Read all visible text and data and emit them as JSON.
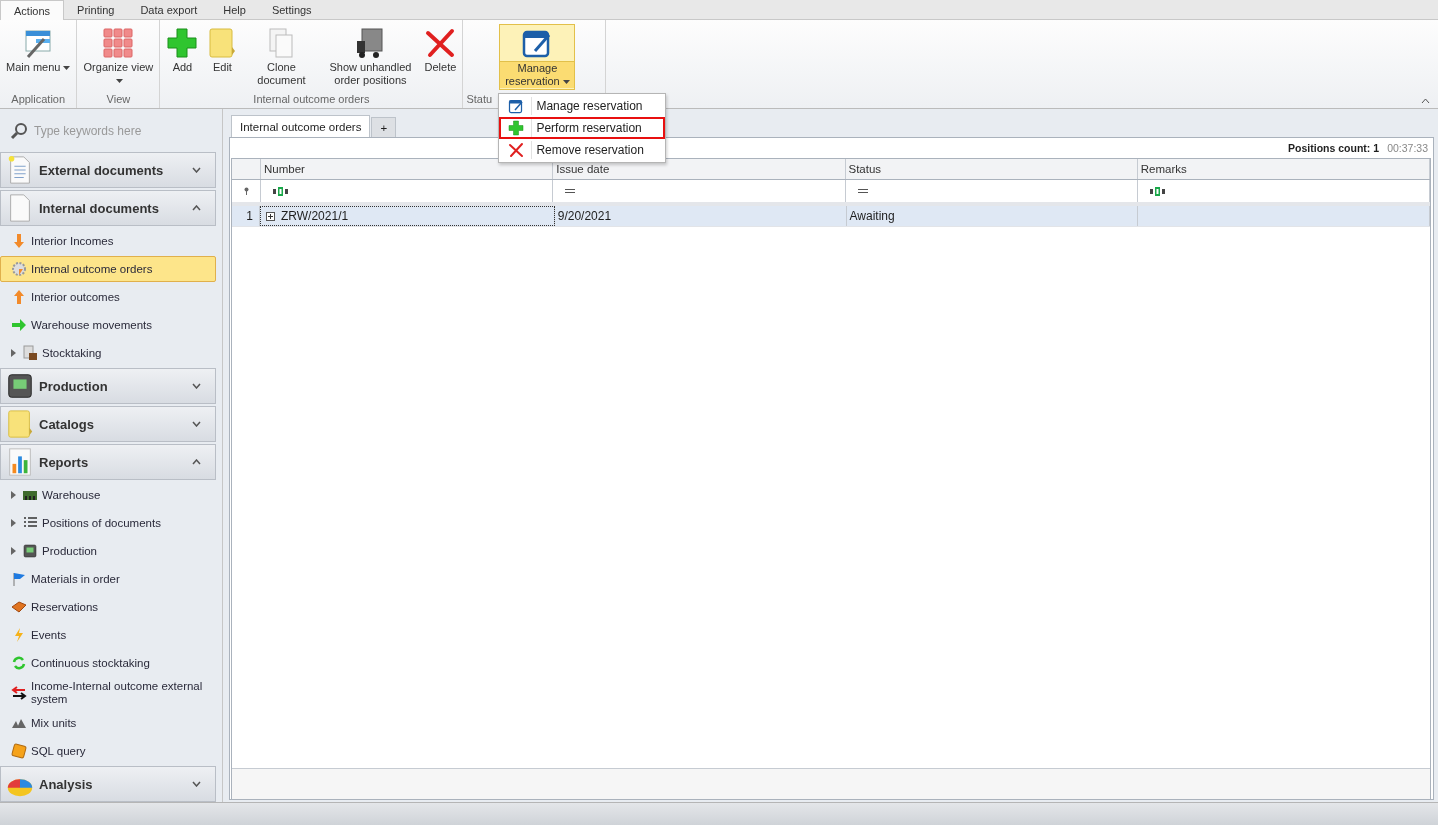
{
  "ribbon_tabs": [
    {
      "label": "Actions",
      "selected": true
    },
    {
      "label": "Printing",
      "selected": false
    },
    {
      "label": "Data export",
      "selected": false
    },
    {
      "label": "Help",
      "selected": false
    },
    {
      "label": "Settings",
      "selected": false
    }
  ],
  "ribbon_groups": [
    {
      "label": "Application",
      "buttons": [
        {
          "label": "Main menu",
          "dropdown": true,
          "expanded": false
        }
      ]
    },
    {
      "label": "View",
      "buttons": [
        {
          "label": "Organize view",
          "dropdown": true,
          "expanded": false
        }
      ]
    },
    {
      "label": "Internal outcome orders",
      "buttons": [
        {
          "label": "Add",
          "dropdown": false,
          "expanded": false
        },
        {
          "label": "Edit",
          "dropdown": false,
          "expanded": false
        },
        {
          "label": "Clone document",
          "dropdown": false,
          "expanded": false
        },
        {
          "label": "Show unhandled order positions",
          "dropdown": false,
          "expanded": false
        },
        {
          "label": "Delete",
          "dropdown": false,
          "expanded": false
        }
      ]
    },
    {
      "label": "Statu",
      "buttons": [
        {
          "label": "Manage reservation",
          "dropdown": true,
          "expanded": true
        }
      ]
    }
  ],
  "dropdown_menu": [
    {
      "label": "Manage reservation",
      "selected": false
    },
    {
      "label": "Perform reservation",
      "selected": true
    },
    {
      "label": "Remove reservation",
      "selected": false
    }
  ],
  "sidebar": {
    "search_placeholder": "Type keywords here",
    "sections": [
      {
        "title": "External documents",
        "expanded": false
      },
      {
        "title": "Internal documents",
        "expanded": true,
        "items": [
          {
            "label": "Interior Incomes",
            "selected": false,
            "has_children": false
          },
          {
            "label": "Internal outcome orders",
            "selected": true,
            "has_children": false
          },
          {
            "label": "Interior outcomes",
            "selected": false,
            "has_children": false
          },
          {
            "label": "Warehouse movements",
            "selected": false,
            "has_children": false
          },
          {
            "label": "Stocktaking",
            "selected": false,
            "has_children": true
          }
        ]
      },
      {
        "title": "Production",
        "expanded": false
      },
      {
        "title": "Catalogs",
        "expanded": false
      },
      {
        "title": "Reports",
        "expanded": true,
        "items": [
          {
            "label": "Warehouse",
            "selected": false,
            "has_children": true
          },
          {
            "label": "Positions of documents",
            "selected": false,
            "has_children": true
          },
          {
            "label": "Production",
            "selected": false,
            "has_children": true
          },
          {
            "label": "Materials in order",
            "selected": false,
            "has_children": false
          },
          {
            "label": "Reservations",
            "selected": false,
            "has_children": false
          },
          {
            "label": "Events",
            "selected": false,
            "has_children": false
          },
          {
            "label": "Continuous stocktaking",
            "selected": false,
            "has_children": false
          },
          {
            "label": "Income-Internal outcome external system",
            "selected": false,
            "has_children": false
          },
          {
            "label": "Mix units",
            "selected": false,
            "has_children": false
          },
          {
            "label": "SQL query",
            "selected": false,
            "has_children": false
          }
        ]
      },
      {
        "title": "Analysis",
        "expanded": false
      }
    ]
  },
  "document_tabs": [
    {
      "label": "Internal outcome orders",
      "selected": true
    },
    {
      "label": "+",
      "selected": false
    }
  ],
  "grid": {
    "positions_count": "Positions count: 1",
    "elapsed": "00:37:33",
    "columns": [
      {
        "title": "Number",
        "kind": "text"
      },
      {
        "title": "Issue date",
        "kind": "equals"
      },
      {
        "title": "Status",
        "kind": "equals"
      },
      {
        "title": "Remarks",
        "kind": "text"
      }
    ],
    "rows": [
      {
        "index": "1",
        "expandable": true,
        "selected": true,
        "cells": [
          "ZRW/2021/1",
          "9/20/2021",
          "Awaiting",
          ""
        ]
      }
    ]
  }
}
